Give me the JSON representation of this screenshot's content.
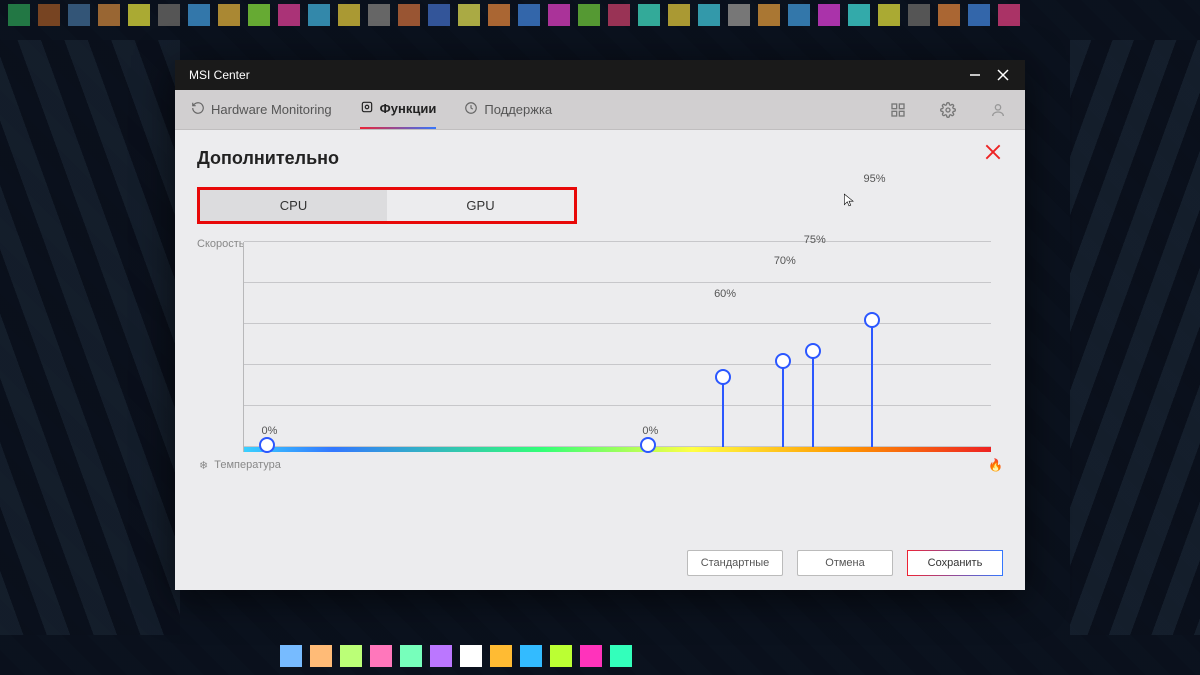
{
  "window": {
    "title": "MSI Center"
  },
  "tabs": {
    "hardware": "Hardware Monitoring",
    "functions": "Функции",
    "support": "Поддержка"
  },
  "page": {
    "heading": "Дополнительно",
    "subtabs": {
      "cpu": "CPU",
      "gpu": "GPU"
    }
  },
  "chart_data": {
    "type": "line",
    "ylabel": "Скорость",
    "xlabel": "Температура",
    "ylim": [
      0,
      100
    ],
    "xlim": [
      0,
      100
    ],
    "gridlines_y": [
      0,
      20,
      40,
      60,
      80,
      100
    ],
    "points": [
      {
        "x": 3,
        "y": 0,
        "label": "0%"
      },
      {
        "x": 54,
        "y": 0,
        "label": "0%"
      },
      {
        "x": 64,
        "y": 34,
        "label": "60%"
      },
      {
        "x": 72,
        "y": 42,
        "label": "70%"
      },
      {
        "x": 76,
        "y": 47,
        "label": "75%"
      },
      {
        "x": 84,
        "y": 62,
        "label": "95%"
      }
    ]
  },
  "buttons": {
    "standard": "Стандартные",
    "cancel": "Отмена",
    "save": "Сохранить"
  },
  "colors": {
    "highlight_box": "#e80808",
    "slider": "#2b57ff",
    "close": "#e22"
  }
}
